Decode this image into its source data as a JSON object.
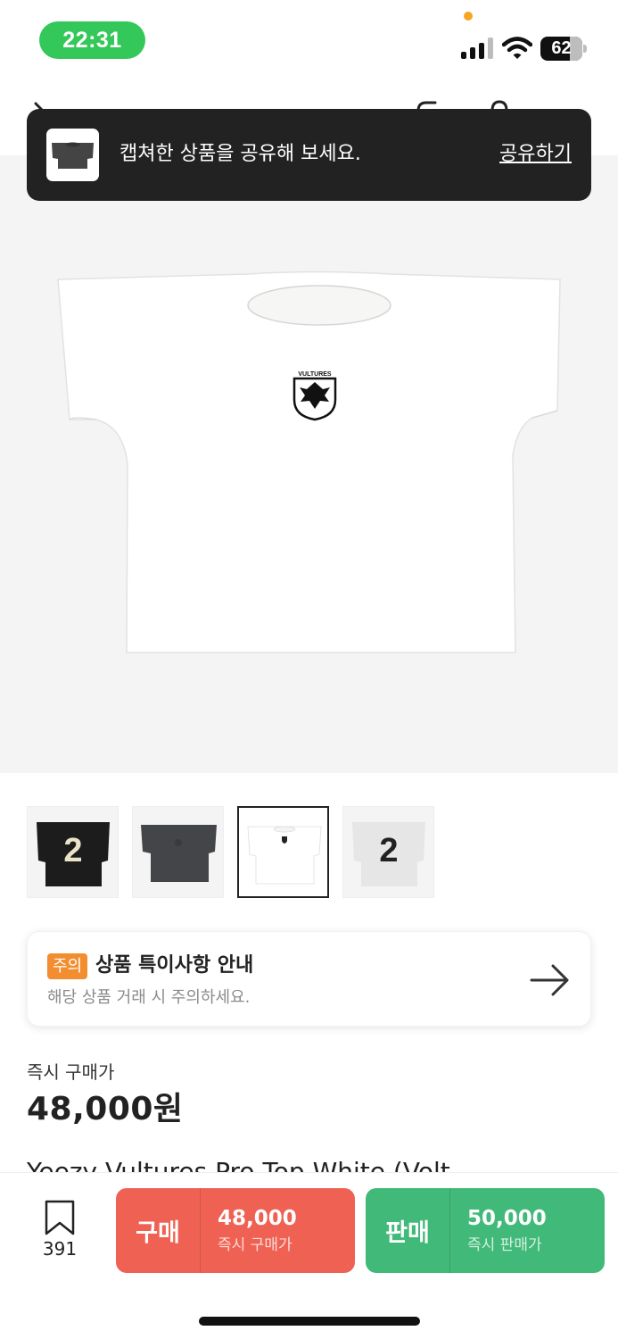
{
  "status_bar": {
    "time": "22:31",
    "battery_level": "62",
    "accent_color": "#34c759"
  },
  "toast": {
    "message": "캡쳐한 상품을 공유해 보세요.",
    "action_label": "공유하기"
  },
  "product": {
    "print_text": "VULTURES",
    "thumbnails": [
      {
        "variant": "black",
        "number": "2"
      },
      {
        "variant": "charcoal",
        "number": ""
      },
      {
        "variant": "white",
        "number": "",
        "selected": true
      },
      {
        "variant": "grey",
        "number": "2"
      }
    ]
  },
  "notice": {
    "badge": "주의",
    "title": "상품 특이사항 안내",
    "subtitle": "해당 상품 거래 시 주의하세요."
  },
  "price": {
    "label": "즉시 구매가",
    "value": "48,000원"
  },
  "product_name_partial": "Yeezy Vultures Pro Top White (Volt",
  "action_bar": {
    "bookmark_count": "391",
    "buy": {
      "kind": "구매",
      "amount": "48,000",
      "caption": "즉시 구매가",
      "color": "#ef6253"
    },
    "sell": {
      "kind": "판매",
      "amount": "50,000",
      "caption": "즉시 판매가",
      "color": "#41b979"
    }
  }
}
